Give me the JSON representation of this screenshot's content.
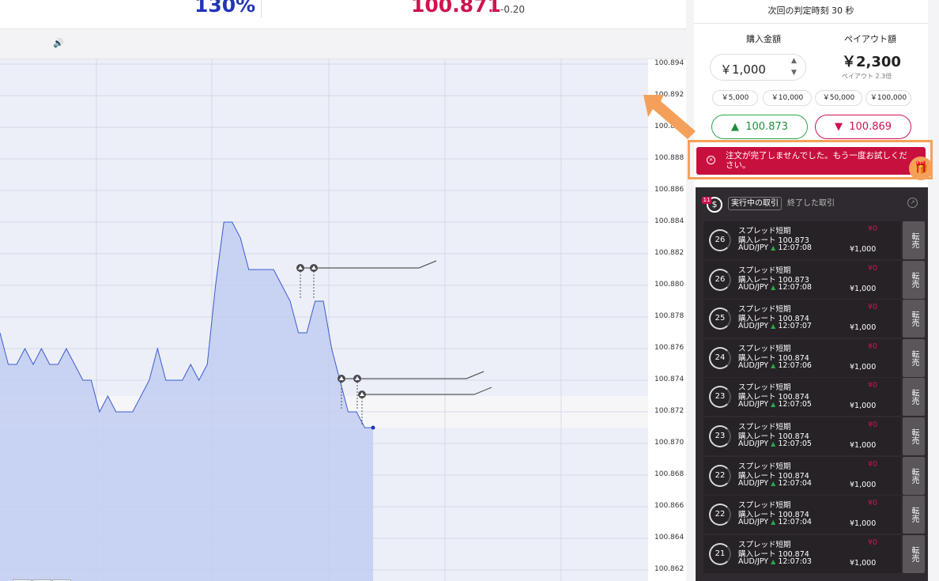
{
  "header": {
    "payout_pct": "130%",
    "rate": "100.871",
    "change": "-0.20"
  },
  "subbar": {
    "sound_icon": "speaker-icon"
  },
  "chart_data": {
    "type": "line",
    "y_ticks": [
      "100.894",
      "100.892",
      "100.890",
      "100.888",
      "100.886",
      "100.884",
      "100.882",
      "100.880",
      "100.878",
      "100.876",
      "100.874",
      "100.872",
      "100.870",
      "100.868",
      "100.866",
      "100.864",
      "100.862"
    ],
    "ylim": [
      100.861,
      100.895
    ],
    "series": [
      {
        "values": [
          100.877,
          100.875,
          100.875,
          100.876,
          100.875,
          100.876,
          100.875,
          100.875,
          100.876,
          100.875,
          100.874,
          100.874,
          100.872,
          100.873,
          100.872,
          100.872,
          100.872,
          100.873,
          100.874,
          100.876,
          100.874,
          100.874,
          100.874,
          100.875,
          100.874,
          100.875,
          100.88,
          100.884,
          100.884,
          100.883,
          100.881,
          100.881,
          100.881,
          100.881,
          100.88,
          100.879,
          100.877,
          100.877,
          100.879,
          100.879,
          100.876,
          100.874,
          100.872,
          100.872,
          100.871,
          100.871
        ]
      }
    ],
    "grid": true
  },
  "panel": {
    "judge_text": "次回の判定時刻 30 秒",
    "buy_label": "購入金額",
    "payout_label": "ペイアウト額",
    "amount": "￥1,000",
    "payout_value": "￥2,300",
    "payout_sub": "ペイアウト 2.3倍",
    "quick": [
      "￥5,000",
      "￥10,000",
      "￥50,000",
      "￥100,000"
    ],
    "up_rate": "100.873",
    "down_rate": "100.869",
    "error_text": "注文が完了しませんでした。もう一度お試しください。"
  },
  "trades": {
    "badge": "11",
    "tab_active": "実行中の取引",
    "tab_done": "終了した取引",
    "sell_label": "転売",
    "rows": [
      {
        "timer": "26",
        "type": "スプレッド短期",
        "rate": "購入レート 100.873",
        "pair": "AUD/JPY",
        "time": "12:07:08",
        "pl": "¥0",
        "amount": "¥1,000"
      },
      {
        "timer": "26",
        "type": "スプレッド短期",
        "rate": "購入レート 100.873",
        "pair": "AUD/JPY",
        "time": "12:07:08",
        "pl": "¥0",
        "amount": "¥1,000"
      },
      {
        "timer": "25",
        "type": "スプレッド短期",
        "rate": "購入レート 100.874",
        "pair": "AUD/JPY",
        "time": "12:07:07",
        "pl": "¥0",
        "amount": "¥1,000"
      },
      {
        "timer": "24",
        "type": "スプレッド短期",
        "rate": "購入レート 100.874",
        "pair": "AUD/JPY",
        "time": "12:07:06",
        "pl": "¥0",
        "amount": "¥1,000"
      },
      {
        "timer": "23",
        "type": "スプレッド短期",
        "rate": "購入レート 100.874",
        "pair": "AUD/JPY",
        "time": "12:07:05",
        "pl": "¥0",
        "amount": "¥1,000"
      },
      {
        "timer": "23",
        "type": "スプレッド短期",
        "rate": "購入レート 100.874",
        "pair": "AUD/JPY",
        "time": "12:07:05",
        "pl": "¥0",
        "amount": "¥1,000"
      },
      {
        "timer": "22",
        "type": "スプレッド短期",
        "rate": "購入レート 100.874",
        "pair": "AUD/JPY",
        "time": "12:07:04",
        "pl": "¥0",
        "amount": "¥1,000"
      },
      {
        "timer": "22",
        "type": "スプレッド短期",
        "rate": "購入レート 100.874",
        "pair": "AUD/JPY",
        "time": "12:07:04",
        "pl": "¥0",
        "amount": "¥1,000"
      },
      {
        "timer": "21",
        "type": "スプレッド短期",
        "rate": "購入レート 100.874",
        "pair": "AUD/JPY",
        "time": "12:07:03",
        "pl": "¥0",
        "amount": "¥1,000"
      }
    ]
  },
  "colors": {
    "up": "#29a84a",
    "down": "#d0124f",
    "accent": "#f5a05a",
    "line": "#3c5bd0",
    "fill": "#c2cdf1"
  }
}
